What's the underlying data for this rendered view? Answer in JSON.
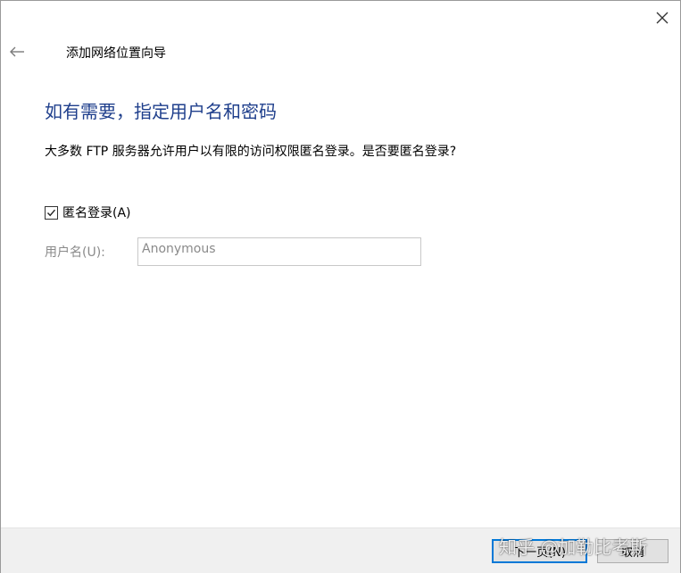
{
  "window": {
    "title": "添加网络位置向导"
  },
  "page": {
    "heading": "如有需要，指定用户名和密码",
    "description": "大多数 FTP 服务器允许用户以有限的访问权限匿名登录。是否要匿名登录?"
  },
  "anonymous_login": {
    "label": "匿名登录(A)",
    "checked": true
  },
  "username": {
    "label": "用户名(U):",
    "value": "Anonymous",
    "disabled": true
  },
  "buttons": {
    "next_label": "下一页(N)",
    "cancel_label": "取消"
  },
  "watermark": {
    "text": "知乎 @加勒比考斯"
  },
  "colors": {
    "heading": "#1f3f8c",
    "accent": "#0078d7",
    "disabled_text": "#8a8a8a",
    "footer_bg": "#f0f0f0"
  },
  "icons": {
    "close": "close-icon",
    "back": "back-arrow-icon",
    "check": "checkmark-icon"
  }
}
